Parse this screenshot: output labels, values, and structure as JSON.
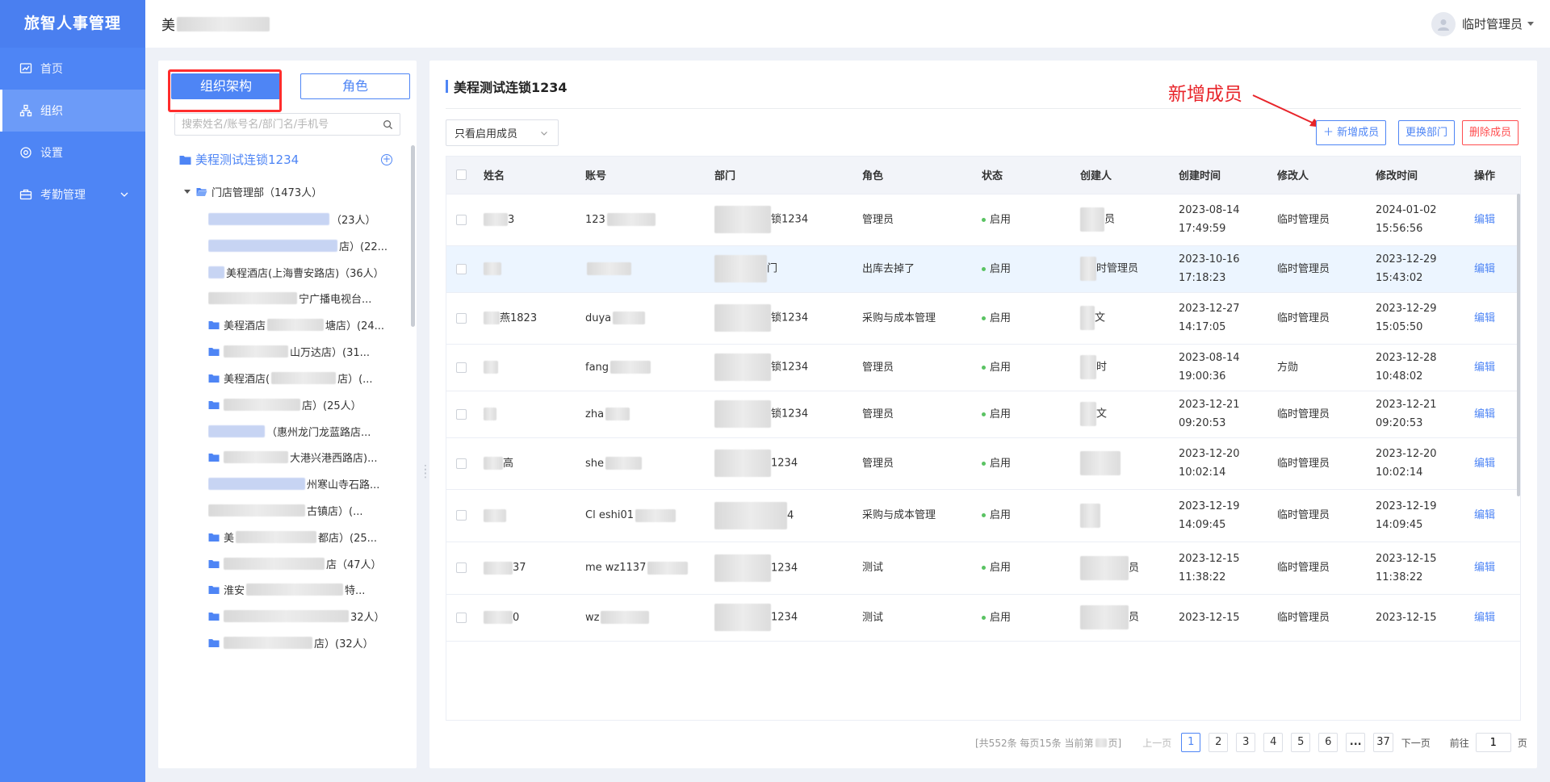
{
  "app": {
    "brand": "旅智人事管理",
    "header_title_prefix": "美"
  },
  "sidebar": {
    "items": [
      {
        "label": "首页"
      },
      {
        "label": "组织"
      },
      {
        "label": "设置"
      },
      {
        "label": "考勤管理"
      }
    ]
  },
  "user": {
    "name": "临时管理员"
  },
  "tree": {
    "tab_org": "组织架构",
    "tab_role": "角色",
    "search_placeholder": "搜索姓名/账号名/部门名/手机号",
    "root": "美程测试连锁1234",
    "dept": "门店管理部（1473人）",
    "leaves": [
      "（23人）",
      "店）(22...",
      "美程酒店(上海曹安路店)（36人）",
      "宁广播电视台...",
      "美程酒店",
      "塘店）(24...",
      "山万达店）(31...",
      "美程酒店(",
      "店）(...",
      "店）(25人）",
      "（惠州龙门龙蓝路店...",
      "大港兴港西路店)...",
      "州寒山寺石路...",
      "古镇店）(...",
      "美",
      "都店）(25...",
      "店（47人）",
      "淮安",
      "特...",
      "32人）",
      "店）(32人）"
    ]
  },
  "main": {
    "title": "美程测试连锁1234",
    "filter": "只看启用成员",
    "btn_add": "＋ 新增成员",
    "btn_change_dept": "更换部门",
    "btn_delete": "删除成员",
    "annotation": "新增成员"
  },
  "table": {
    "columns": [
      "姓名",
      "账号",
      "部门",
      "角色",
      "状态",
      "创建人",
      "创建时间",
      "修改人",
      "修改时间",
      "操作"
    ],
    "rows": [
      {
        "name": "3",
        "account": "123",
        "dept": "锁1234",
        "role": "管理员",
        "status": "启用",
        "creator": "员",
        "created_date": "2023-08-14",
        "created_time": "17:49:59",
        "modifier": "临时管理员",
        "modified_date": "2024-01-02",
        "modified_time": "15:56:56",
        "action": "编辑"
      },
      {
        "name": "",
        "account": "",
        "dept": "门",
        "role": "出库去掉了",
        "status": "启用",
        "creator": "时管理员",
        "created_date": "2023-10-16",
        "created_time": "17:18:23",
        "modifier": "临时管理员",
        "modified_date": "2023-12-29",
        "modified_time": "15:43:02",
        "action": "编辑"
      },
      {
        "name": "燕1823",
        "account": "duya",
        "dept": "锁1234",
        "role": "采购与成本管理",
        "status": "启用",
        "creator": "文",
        "created_date": "2023-12-27",
        "created_time": "14:17:05",
        "modifier": "临时管理员",
        "modified_date": "2023-12-29",
        "modified_time": "15:05:50",
        "action": "编辑"
      },
      {
        "name": "",
        "account": "fang",
        "dept": "锁1234",
        "role": "管理员",
        "status": "启用",
        "creator": "时",
        "created_date": "2023-08-14",
        "created_time": "19:00:36",
        "modifier": "方勋",
        "modified_date": "2023-12-28",
        "modified_time": "10:48:02",
        "action": "编辑"
      },
      {
        "name": "",
        "account": "zha",
        "dept": "锁1234",
        "role": "管理员",
        "status": "启用",
        "creator": "文",
        "created_date": "2023-12-21",
        "created_time": "09:20:53",
        "modifier": "临时管理员",
        "modified_date": "2023-12-21",
        "modified_time": "09:20:53",
        "action": "编辑"
      },
      {
        "name": "高",
        "account": "she",
        "dept": "1234",
        "role": "管理员",
        "status": "启用",
        "creator": "",
        "created_date": "2023-12-20",
        "created_time": "10:02:14",
        "modifier": "临时管理员",
        "modified_date": "2023-12-20",
        "modified_time": "10:02:14",
        "action": "编辑"
      },
      {
        "name": "",
        "account": "Cl eshi01",
        "dept": "4",
        "role": "采购与成本管理",
        "status": "启用",
        "creator": "",
        "created_date": "2023-12-19",
        "created_time": "14:09:45",
        "modifier": "临时管理员",
        "modified_date": "2023-12-19",
        "modified_time": "14:09:45",
        "action": "编辑"
      },
      {
        "name": "37",
        "account": "me wz1137",
        "dept": "1234",
        "role": "测试",
        "status": "启用",
        "creator": "员",
        "created_date": "2023-12-15",
        "created_time": "11:38:22",
        "modifier": "临时管理员",
        "modified_date": "2023-12-15",
        "modified_time": "11:38:22",
        "action": "编辑"
      },
      {
        "name": "0",
        "account": "wz",
        "dept": "1234",
        "role": "测试",
        "status": "启用",
        "creator": "员",
        "created_date": "2023-12-15",
        "created_time": "",
        "modifier": "临时管理员",
        "modified_date": "2023-12-15",
        "modified_time": "",
        "action": "编辑"
      }
    ]
  },
  "pagination": {
    "info": "[共552条 每页15条 当前第",
    "info_end": "页]",
    "prev": "上一页",
    "pages": [
      "1",
      "2",
      "3",
      "4",
      "5",
      "6",
      "...",
      "37"
    ],
    "current": "1",
    "next": "下一页",
    "goto_label": "前往",
    "goto_value": "1",
    "goto_suffix": "页"
  },
  "colors": {
    "primary": "#4e85f5",
    "danger": "#ff4d4f",
    "annotation": "#e8242a",
    "status_enabled": "#5ac363"
  }
}
